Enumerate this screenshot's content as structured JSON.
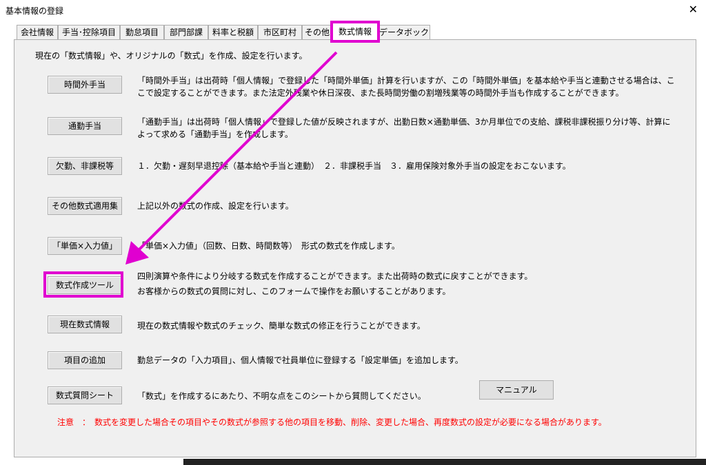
{
  "window": {
    "title": "基本情報の登録",
    "close_glyph": "✕"
  },
  "tabs": [
    {
      "label": "会社情報"
    },
    {
      "label": "手当･控除項目"
    },
    {
      "label": "勤怠項目"
    },
    {
      "label": "部門部課"
    },
    {
      "label": "料率と税額"
    },
    {
      "label": "市区町村"
    },
    {
      "label": "その他"
    },
    {
      "label": "数式情報",
      "active": true
    },
    {
      "label": "データボックス"
    }
  ],
  "main": {
    "intro": "現在の「数式情報」や、オリジナルの「数式」を作成、設定を行います。",
    "rows": [
      {
        "button": "時間外手当",
        "desc": "「時間外手当」は出荷時「個人情報」で登録した「時間外単価」計算を行いますが、この「時間外単価」を基本給や手当と連動させる場合は、ここで設定することができます。また法定外残業や休日深夜、また長時間労働の割増残業等の時間外手当も作成することができます。"
      },
      {
        "button": "通勤手当",
        "desc": "「通勤手当」は出荷時「個人情報」で登録した値が反映されますが、出勤日数×通勤単価、3か月単位での支給、課税非課税振り分け等、計算によって求める「通勤手当」を作成します。"
      },
      {
        "button": "欠勤、非課税等",
        "desc": "１．欠勤・遅刻早退控除（基本給や手当と連動）　２．非課税手当　３．雇用保険対象外手当の設定をおこないます。"
      },
      {
        "button": "その他数式適用集",
        "desc": "上記以外の数式の作成、設定を行います。"
      },
      {
        "button": "「単価×入力値」",
        "desc": "「単価×入力値」（回数、日数、時間数等）　形式の数式を作成します。"
      },
      {
        "button": "数式作成ツール",
        "desc": "四則演算や条件により分岐する数式を作成することができます。また出荷時の数式に戻すことができます。",
        "desc2": "お客様からの数式の質問に対し、このフォームで操作をお願いすることがあります。"
      },
      {
        "button": "現在数式情報",
        "desc": "現在の数式情報や数式のチェック、簡単な数式の修正を行うことができます。"
      },
      {
        "button": "項目の追加",
        "desc": "勤怠データの「入力項目」、個人情報で社員単位に登録する「設定単価」を追加します。"
      },
      {
        "button": "数式質問シート",
        "desc": "「数式」を作成するにあたり、不明な点をこのシートから質問してください。"
      }
    ],
    "manual_button": "マニュアル",
    "notice": "注意　：　数式を変更した場合その項目やその数式が参照する他の項目を移動、削除、変更した場合、再度数式の設定が必要になる場合があります。"
  },
  "annotation": {
    "highlight_color": "#e000d0"
  }
}
